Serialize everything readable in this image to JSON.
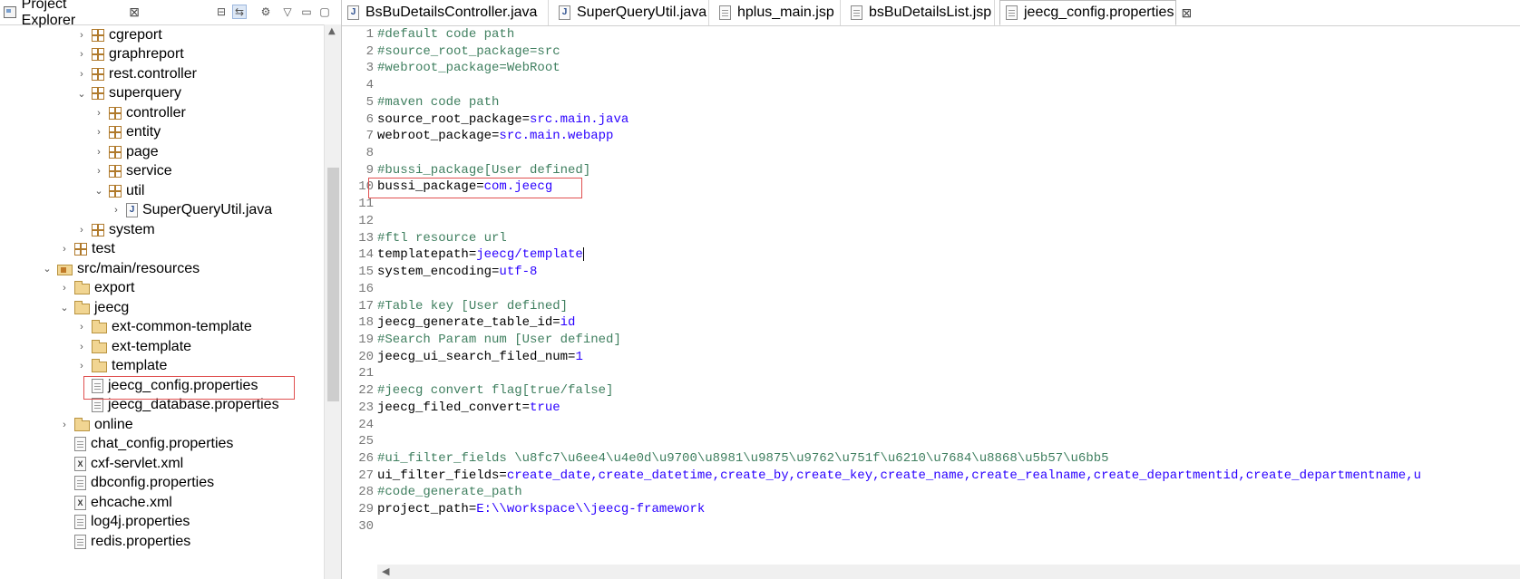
{
  "explorer": {
    "title": "Project Explorer",
    "close": "⊠",
    "tree": [
      {
        "label": "cgreport",
        "icon": "package-icon",
        "toggle": "›",
        "indent": 1
      },
      {
        "label": "graphreport",
        "icon": "package-icon",
        "toggle": "›",
        "indent": 1
      },
      {
        "label": "rest.controller",
        "icon": "package-icon",
        "toggle": "›",
        "indent": 1
      },
      {
        "label": "superquery",
        "icon": "package-icon",
        "toggle": "⌄",
        "indent": 1
      },
      {
        "label": "controller",
        "icon": "package-icon",
        "toggle": "›",
        "indent": 2
      },
      {
        "label": "entity",
        "icon": "package-icon",
        "toggle": "›",
        "indent": 2
      },
      {
        "label": "page",
        "icon": "package-icon",
        "toggle": "›",
        "indent": 2
      },
      {
        "label": "service",
        "icon": "package-icon",
        "toggle": "›",
        "indent": 2
      },
      {
        "label": "util",
        "icon": "package-icon",
        "toggle": "⌄",
        "indent": 2
      },
      {
        "label": "SuperQueryUtil.java",
        "icon": "java-file-icon",
        "toggle": "›",
        "indent": 3
      },
      {
        "label": "system",
        "icon": "package-icon",
        "toggle": "›",
        "indent": 1
      },
      {
        "label": "test",
        "icon": "package-icon",
        "toggle": "›",
        "indent": 0
      },
      {
        "label": "src/main/resources",
        "icon": "source-folder-icon",
        "toggle": "⌄",
        "indent": -1
      },
      {
        "label": "export",
        "icon": "folder-icon",
        "toggle": "›",
        "indent": 0
      },
      {
        "label": "jeecg",
        "icon": "folder-icon",
        "toggle": "⌄",
        "indent": 0
      },
      {
        "label": "ext-common-template",
        "icon": "folder-icon",
        "toggle": "›",
        "indent": 1
      },
      {
        "label": "ext-template",
        "icon": "folder-icon",
        "toggle": "›",
        "indent": 1
      },
      {
        "label": "template",
        "icon": "folder-icon",
        "toggle": "›",
        "indent": 1
      },
      {
        "label": "jeecg_config.properties",
        "icon": "properties-file-icon",
        "toggle": "",
        "indent": 1
      },
      {
        "label": "jeecg_database.properties",
        "icon": "properties-file-icon",
        "toggle": "",
        "indent": 1
      },
      {
        "label": "online",
        "icon": "folder-icon",
        "toggle": "›",
        "indent": 0
      },
      {
        "label": "chat_config.properties",
        "icon": "properties-file-icon",
        "toggle": "",
        "indent": 0
      },
      {
        "label": "cxf-servlet.xml",
        "icon": "xml-file-icon",
        "toggle": "",
        "indent": 0
      },
      {
        "label": "dbconfig.properties",
        "icon": "properties-file-icon",
        "toggle": "",
        "indent": 0
      },
      {
        "label": "ehcache.xml",
        "icon": "xml-file-icon",
        "toggle": "",
        "indent": 0
      },
      {
        "label": "log4j.properties",
        "icon": "properties-file-icon",
        "toggle": "",
        "indent": 0
      },
      {
        "label": "redis.properties",
        "icon": "properties-file-icon",
        "toggle": "",
        "indent": 0
      }
    ]
  },
  "tabs": [
    {
      "label": "BsBuDetailsController.java",
      "icon": "java-file-icon",
      "active": false
    },
    {
      "label": "SuperQueryUtil.java",
      "icon": "java-file-icon",
      "active": false
    },
    {
      "label": "hplus_main.jsp",
      "icon": "jsp-file-icon",
      "active": false
    },
    {
      "label": "bsBuDetailsList.jsp",
      "icon": "jsp-file-icon",
      "active": false
    },
    {
      "label": "jeecg_config.properties",
      "icon": "properties-file-icon",
      "active": true,
      "close": "⊠"
    }
  ],
  "editor": {
    "lines": [
      {
        "n": "1",
        "k": "#default code path",
        "v": "",
        "type": "comment"
      },
      {
        "n": "2",
        "k": "#source_root_package=src",
        "v": "",
        "type": "comment"
      },
      {
        "n": "3",
        "k": "#webroot_package=WebRoot",
        "v": "",
        "type": "comment"
      },
      {
        "n": "4",
        "k": "",
        "v": "",
        "type": "blank"
      },
      {
        "n": "5",
        "k": "#maven code path",
        "v": "",
        "type": "comment"
      },
      {
        "n": "6",
        "k": "source_root_package=",
        "v": "src.main.java",
        "type": "kv"
      },
      {
        "n": "7",
        "k": "webroot_package=",
        "v": "src.main.webapp",
        "type": "kv"
      },
      {
        "n": "8",
        "k": "",
        "v": "",
        "type": "blank"
      },
      {
        "n": "9",
        "k": "#bussi_package[User defined]",
        "v": "",
        "type": "comment"
      },
      {
        "n": "10",
        "k": "bussi_package=",
        "v": "com.jeecg",
        "type": "kv"
      },
      {
        "n": "11",
        "k": "",
        "v": "",
        "type": "blank"
      },
      {
        "n": "12",
        "k": "",
        "v": "",
        "type": "blank"
      },
      {
        "n": "13",
        "k": "#ftl resource url",
        "v": "",
        "type": "comment"
      },
      {
        "n": "14",
        "k": "templatepath=",
        "v": "jeecg/template",
        "type": "kv"
      },
      {
        "n": "15",
        "k": "system_encoding=",
        "v": "utf-8",
        "type": "kv"
      },
      {
        "n": "16",
        "k": "",
        "v": "",
        "type": "blank"
      },
      {
        "n": "17",
        "k": "#Table key [User defined]",
        "v": "",
        "type": "comment"
      },
      {
        "n": "18",
        "k": "jeecg_generate_table_id=",
        "v": "id",
        "type": "kv"
      },
      {
        "n": "19",
        "k": "#Search Param num [User defined]",
        "v": "",
        "type": "comment"
      },
      {
        "n": "20",
        "k": "jeecg_ui_search_filed_num=",
        "v": "1",
        "type": "kv"
      },
      {
        "n": "21",
        "k": "",
        "v": "",
        "type": "blank"
      },
      {
        "n": "22",
        "k": "#jeecg convert flag[true/false]",
        "v": "",
        "type": "comment"
      },
      {
        "n": "23",
        "k": "jeecg_filed_convert=",
        "v": "true",
        "type": "kv"
      },
      {
        "n": "24",
        "k": "",
        "v": "",
        "type": "blank"
      },
      {
        "n": "25",
        "k": "",
        "v": "",
        "type": "blank"
      },
      {
        "n": "26",
        "k": "#ui_filter_fields \\u8fc7\\u6ee4\\u4e0d\\u9700\\u8981\\u9875\\u9762\\u751f\\u6210\\u7684\\u8868\\u5b57\\u6bb5",
        "v": "",
        "type": "comment"
      },
      {
        "n": "27",
        "k": "ui_filter_fields=",
        "v": "create_date,create_datetime,create_by,create_key,create_name,create_realname,create_departmentid,create_departmentname,u",
        "type": "kv"
      },
      {
        "n": "28",
        "k": "#code_generate_path",
        "v": "",
        "type": "comment"
      },
      {
        "n": "29",
        "k": "project_path=",
        "v": "E:\\\\workspace\\\\jeecg-framework",
        "type": "kv"
      },
      {
        "n": "30",
        "k": "",
        "v": "",
        "type": "blank"
      }
    ],
    "cursor_line": "14"
  },
  "colors": {
    "comment": "#3f7f5f",
    "value": "#2a00ff",
    "highlight_box": "#e05050",
    "line_number": "#787878"
  }
}
